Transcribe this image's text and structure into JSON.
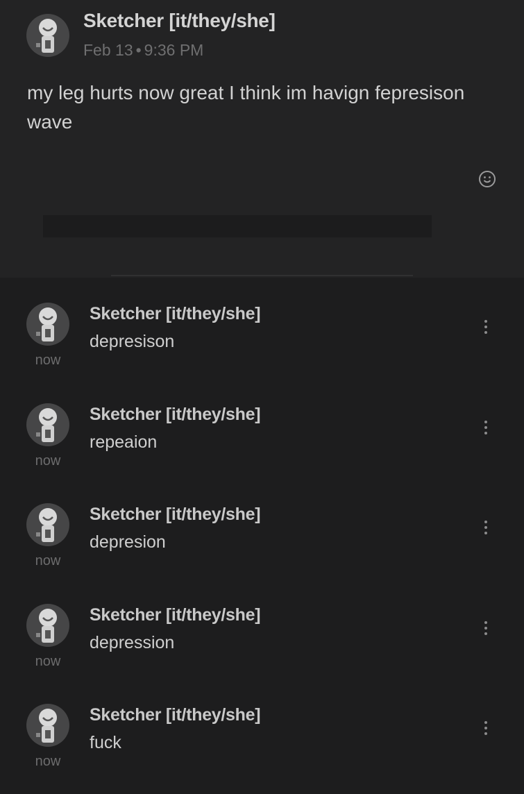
{
  "post": {
    "author": "Sketcher [it/they/she]",
    "date": "Feb 13",
    "separator": "•",
    "time": "9:36 PM",
    "text": "my leg hurts now great I think im havign fepresison wave",
    "react_icon": "smiley-icon"
  },
  "comments": [
    {
      "author": "Sketcher [it/they/she]",
      "text": "depresison",
      "time": "now"
    },
    {
      "author": "Sketcher [it/they/she]",
      "text": "repeaion",
      "time": "now"
    },
    {
      "author": "Sketcher [it/they/she]",
      "text": "depresion",
      "time": "now"
    },
    {
      "author": "Sketcher [it/they/she]",
      "text": "depression",
      "time": "now"
    },
    {
      "author": "Sketcher [it/they/she]",
      "text": "fuck",
      "time": "now"
    }
  ],
  "colors": {
    "background": "#1d1d1e",
    "post_background": "#232324",
    "avatar_background": "#464647"
  }
}
